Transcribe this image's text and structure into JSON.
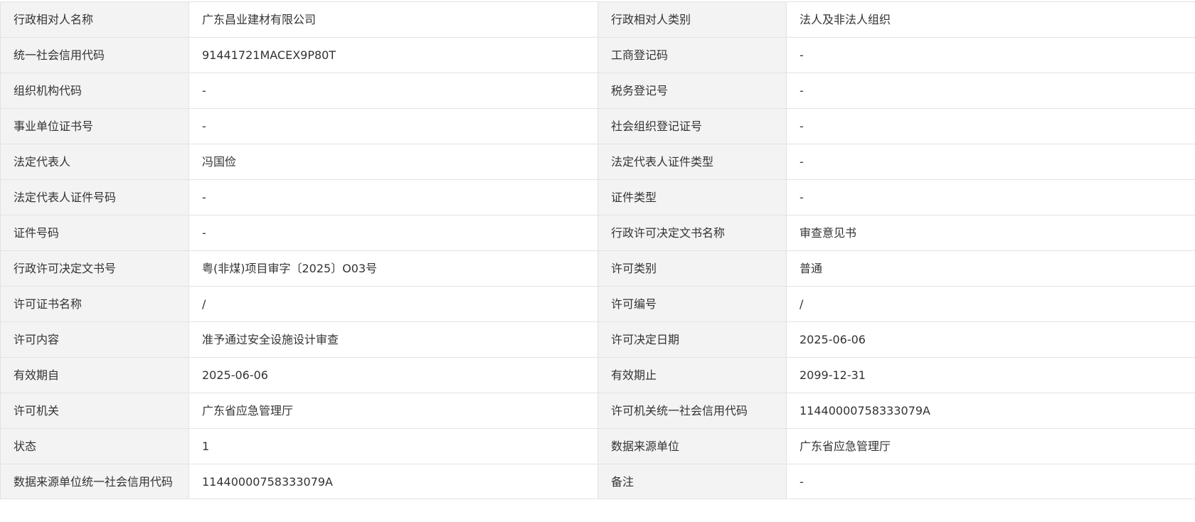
{
  "rows": [
    {
      "l1": "行政相对人名称",
      "v1": "广东昌业建材有限公司",
      "l2": "行政相对人类别",
      "v2": "法人及非法人组织"
    },
    {
      "l1": "统一社会信用代码",
      "v1": "91441721MACEX9P80T",
      "l2": "工商登记码",
      "v2": "-"
    },
    {
      "l1": "组织机构代码",
      "v1": "-",
      "l2": "税务登记号",
      "v2": "-"
    },
    {
      "l1": "事业单位证书号",
      "v1": "-",
      "l2": "社会组织登记证号",
      "v2": "-"
    },
    {
      "l1": "法定代表人",
      "v1": "冯国俭",
      "l2": "法定代表人证件类型",
      "v2": "-"
    },
    {
      "l1": "法定代表人证件号码",
      "v1": "-",
      "l2": "证件类型",
      "v2": "-"
    },
    {
      "l1": "证件号码",
      "v1": "-",
      "l2": "行政许可决定文书名称",
      "v2": "审查意见书"
    },
    {
      "l1": "行政许可决定文书号",
      "v1": "粤(非煤)项目审字〔2025〕O03号",
      "l2": "许可类别",
      "v2": "普通"
    },
    {
      "l1": "许可证书名称",
      "v1": "/",
      "l2": "许可编号",
      "v2": "/"
    },
    {
      "l1": "许可内容",
      "v1": "准予通过安全设施设计审查",
      "l2": "许可决定日期",
      "v2": "2025-06-06"
    },
    {
      "l1": "有效期自",
      "v1": "2025-06-06",
      "l2": "有效期止",
      "v2": "2099-12-31"
    },
    {
      "l1": "许可机关",
      "v1": "广东省应急管理厅",
      "l2": "许可机关统一社会信用代码",
      "v2": "11440000758333079A"
    },
    {
      "l1": "状态",
      "v1": "1",
      "l2": "数据来源单位",
      "v2": "广东省应急管理厅"
    },
    {
      "l1": "数据来源单位统一社会信用代码",
      "v1": "11440000758333079A",
      "l2": "备注",
      "v2": "-"
    }
  ]
}
